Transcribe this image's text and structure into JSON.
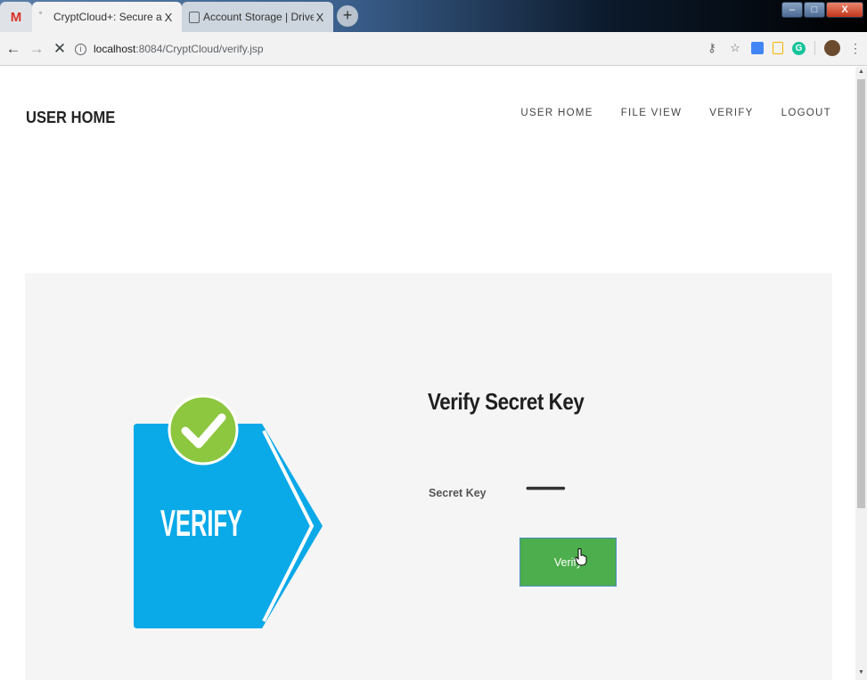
{
  "browser": {
    "tabs": [
      {
        "title": "",
        "icon": "gmail-icon"
      },
      {
        "title": "CryptCloud+: Secure and Expres:",
        "close": "X"
      },
      {
        "title": "Account Storage | DriveHQ",
        "close": "X"
      }
    ],
    "new_tab": "+",
    "window": {
      "minimize": "–",
      "maximize": "□",
      "close": "X"
    },
    "url_host": "localhost",
    "url_path": ":8084/CryptCloud/verify.jsp"
  },
  "header": {
    "brand": "USER HOME",
    "menu": [
      "USER HOME",
      "FILE VIEW",
      "VERIFY",
      "LOGOUT"
    ]
  },
  "graphic": {
    "label": "VERIFY"
  },
  "form": {
    "title": "Verify Secret Key",
    "secret_label": "Secret Key",
    "secret_value": "••••••••••••••••••••••",
    "button_label": "Verify"
  },
  "colors": {
    "graphic_blue": "#0aa9e8",
    "check_green": "#8dc63f",
    "button_green": "#4cae4c",
    "panel_bg": "#f5f5f5"
  }
}
